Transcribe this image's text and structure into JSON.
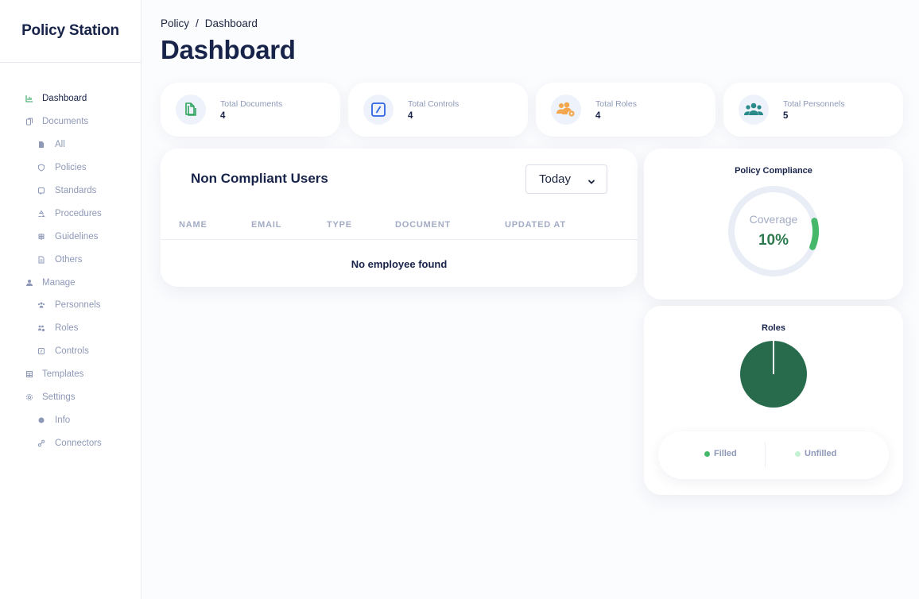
{
  "app": {
    "brand": "Policy Station"
  },
  "breadcrumb": {
    "parent": "Policy",
    "separator": "/",
    "current": "Dashboard"
  },
  "page": {
    "title": "Dashboard"
  },
  "sidebar": {
    "items": [
      {
        "label": "Dashboard",
        "icon": "chart-icon",
        "level": 1,
        "active": true
      },
      {
        "label": "Documents",
        "icon": "documents-icon",
        "level": 1
      },
      {
        "label": "All",
        "icon": "file-icon",
        "level": 2
      },
      {
        "label": "Policies",
        "icon": "shield-icon",
        "level": 2
      },
      {
        "label": "Standards",
        "icon": "bookmark-icon",
        "level": 2
      },
      {
        "label": "Procedures",
        "icon": "recycle-icon",
        "level": 2
      },
      {
        "label": "Guidelines",
        "icon": "signpost-icon",
        "level": 2
      },
      {
        "label": "Others",
        "icon": "file-text-icon",
        "level": 2
      },
      {
        "label": "Manage",
        "icon": "user-icon",
        "level": 1
      },
      {
        "label": "Personnels",
        "icon": "users-icon",
        "level": 2
      },
      {
        "label": "Roles",
        "icon": "users-cog-icon",
        "level": 2
      },
      {
        "label": "Controls",
        "icon": "control-icon",
        "level": 2
      },
      {
        "label": "Templates",
        "icon": "template-icon",
        "level": 1
      },
      {
        "label": "Settings",
        "icon": "gear-icon",
        "level": 1
      },
      {
        "label": "Info",
        "icon": "info-icon",
        "level": 2
      },
      {
        "label": "Connectors",
        "icon": "link-icon",
        "level": 2
      }
    ]
  },
  "stats": [
    {
      "label": "Total Documents",
      "value": "4",
      "icon": "documents-copy-icon",
      "color": "#2fa35f"
    },
    {
      "label": "Total Controls",
      "value": "4",
      "icon": "slash-square-icon",
      "color": "#2f64e0"
    },
    {
      "label": "Total Roles",
      "value": "4",
      "icon": "users-cog-icon",
      "color": "#f3a64b"
    },
    {
      "label": "Total Personnels",
      "value": "5",
      "icon": "users-icon",
      "color": "#2a8a8a"
    }
  ],
  "non_compliant": {
    "title": "Non Compliant Users",
    "filter": "Today",
    "columns": [
      "NAME",
      "EMAIL",
      "TYPE",
      "DOCUMENT",
      "UPDATED AT"
    ],
    "rows": [],
    "empty_message": "No employee found"
  },
  "compliance": {
    "title": "Policy Compliance",
    "label": "Coverage",
    "value_text": "10%",
    "percent": 10,
    "colors": {
      "progress": "#46b86a",
      "track": "#e8edf6",
      "text": "#2e7a4f"
    }
  },
  "roles_chart": {
    "title": "Roles",
    "legend": [
      {
        "label": "Filled",
        "color": "#46b86a"
      },
      {
        "label": "Unfilled",
        "color": "#c5f2d2"
      }
    ]
  },
  "chart_data": {
    "type": "pie",
    "categories": [
      "Filled",
      "Unfilled"
    ],
    "values": [
      100,
      0
    ],
    "colors": [
      "#276a4c",
      "#c5f2d2"
    ],
    "legend": "bottom"
  }
}
